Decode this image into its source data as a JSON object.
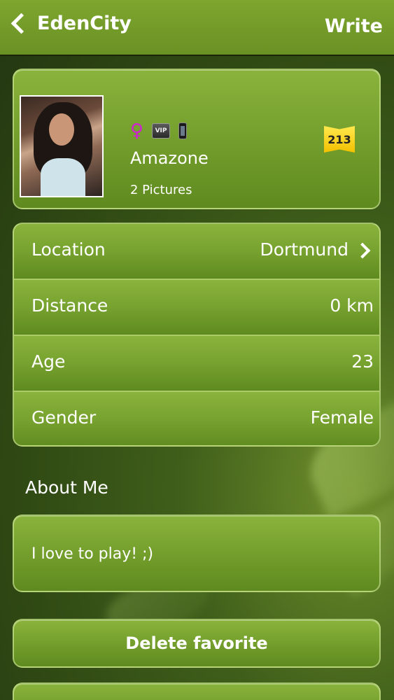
{
  "navbar": {
    "title": "EdenCity",
    "action_label": "Write"
  },
  "profile": {
    "name": "Amazone",
    "pictures_label": "2 Pictures",
    "rank": "213",
    "badges": {
      "gender_symbol": "♀",
      "vip_label": "VIP"
    }
  },
  "info": {
    "rows": [
      {
        "label": "Location",
        "value": "Dortmund"
      },
      {
        "label": "Distance",
        "value": "0 km"
      },
      {
        "label": "Age",
        "value": "23"
      },
      {
        "label": "Gender",
        "value": "Female"
      }
    ]
  },
  "about": {
    "heading": "About Me",
    "text": "I love to play! ;)"
  },
  "actions": {
    "delete_favorite_label": "Delete favorite",
    "second_button_label": ""
  },
  "colors": {
    "nav_bar": "#7ea62e",
    "card_top": "#8ab33c",
    "card_bottom": "#5f8a1f",
    "background": "#2e4713",
    "female_icon": "#d21ed6",
    "rank_badge": "#f2c000"
  }
}
